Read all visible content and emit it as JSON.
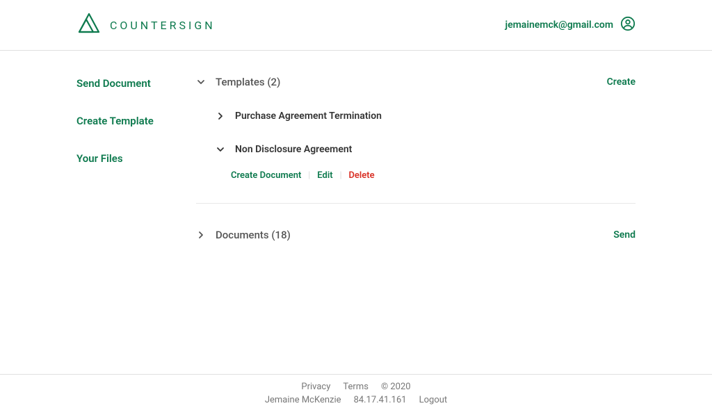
{
  "header": {
    "brand_name": "COUNTERSIGN",
    "user_email": "jemainemck@gmail.com"
  },
  "sidebar": {
    "items": [
      {
        "label": "Send Document"
      },
      {
        "label": "Create Template"
      },
      {
        "label": "Your Files"
      }
    ]
  },
  "sections": {
    "templates": {
      "title": "Templates (2)",
      "action": "Create",
      "items": [
        {
          "name": "Purchase Agreement Termination",
          "expanded": false
        },
        {
          "name": "Non Disclosure Agreement",
          "expanded": true,
          "actions": {
            "create_document": "Create Document",
            "edit": "Edit",
            "delete": "Delete"
          }
        }
      ]
    },
    "documents": {
      "title": "Documents (18)",
      "action": "Send"
    }
  },
  "footer": {
    "row1": {
      "privacy": "Privacy",
      "terms": "Terms",
      "copyright": "© 2020"
    },
    "row2": {
      "user_name": "Jemaine McKenzie",
      "ip": "84.17.41.161",
      "logout": "Logout"
    }
  }
}
